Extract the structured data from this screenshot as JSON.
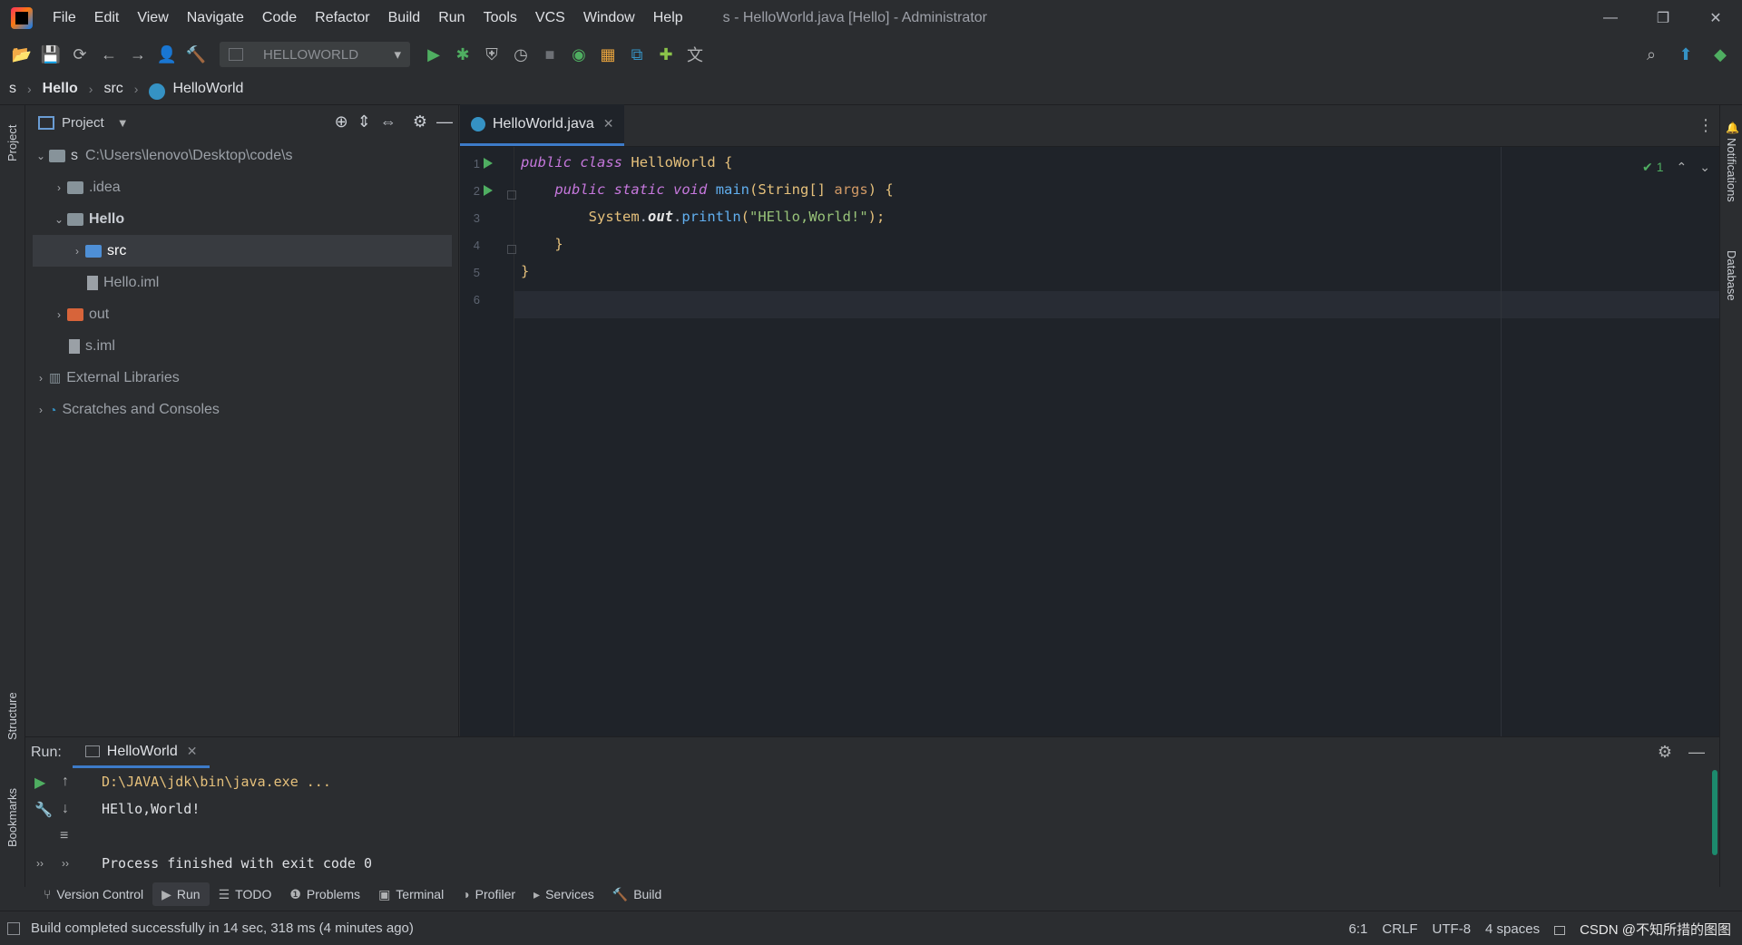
{
  "window": {
    "title": "s - HelloWorld.java [Hello] - Administrator",
    "menu": [
      "File",
      "Edit",
      "View",
      "Navigate",
      "Code",
      "Refactor",
      "Build",
      "Run",
      "Tools",
      "VCS",
      "Window",
      "Help"
    ],
    "controls": {
      "minimize": "—",
      "restore": "❐",
      "close": "✕"
    }
  },
  "toolbar": {
    "run_config": "HELLOWORLD"
  },
  "breadcrumb": [
    "s",
    "Hello",
    "src",
    "HelloWorld"
  ],
  "left_strip": {
    "project": "Project",
    "structure": "Structure",
    "bookmarks": "Bookmarks"
  },
  "right_strip": {
    "notifications": "Notifications",
    "database": "Database"
  },
  "project": {
    "header": "Project",
    "tree": [
      {
        "label": "s",
        "path": "C:\\Users\\lenovo\\Desktop\\code\\s"
      },
      {
        "label": ".idea"
      },
      {
        "label": "Hello"
      },
      {
        "label": "src"
      },
      {
        "label": "Hello.iml"
      },
      {
        "label": "out"
      },
      {
        "label": "s.iml"
      },
      {
        "label": "External Libraries"
      },
      {
        "label": "Scratches and Consoles"
      }
    ]
  },
  "editor": {
    "tab": "HelloWorld.java",
    "line_numbers": [
      "1",
      "2",
      "3",
      "4",
      "5",
      "6"
    ],
    "inspection_count": "1",
    "code": {
      "l1": {
        "kw1": "public",
        "kw2": "class",
        "name": "HelloWorld",
        "brace": " {"
      },
      "l2": {
        "kw1": "public",
        "kw2": "static",
        "kw3": "void",
        "fn": "main",
        "p1": "(",
        "type": "String[]",
        "arg": "args",
        "p2": ") {"
      },
      "l3": {
        "cls": "System",
        "dot1": ".",
        "field": "out",
        "dot2": ".",
        "fn": "println",
        "p1": "(",
        "str": "\"HEllo,World!\"",
        "p2": ");"
      },
      "l4": "}",
      "l5": "}"
    }
  },
  "run": {
    "label": "Run:",
    "tab": "HelloWorld",
    "console": [
      "D:\\JAVA\\jdk\\bin\\java.exe ...",
      "HEllo,World!",
      "",
      "Process finished with exit code 0"
    ]
  },
  "tool_tabs": [
    "Version Control",
    "Run",
    "TODO",
    "Problems",
    "Terminal",
    "Profiler",
    "Services",
    "Build"
  ],
  "status": {
    "message": "Build completed successfully in 14 sec, 318 ms (4 minutes ago)",
    "position": "6:1",
    "line_sep": "CRLF",
    "encoding": "UTF-8",
    "indent": "4 spaces",
    "watermark": "CSDN @不知所措的图图"
  },
  "colors": {
    "accent": "#3d7bc8",
    "run_green": "#4fae61",
    "keyword": "#c678dd",
    "string": "#98c379"
  }
}
